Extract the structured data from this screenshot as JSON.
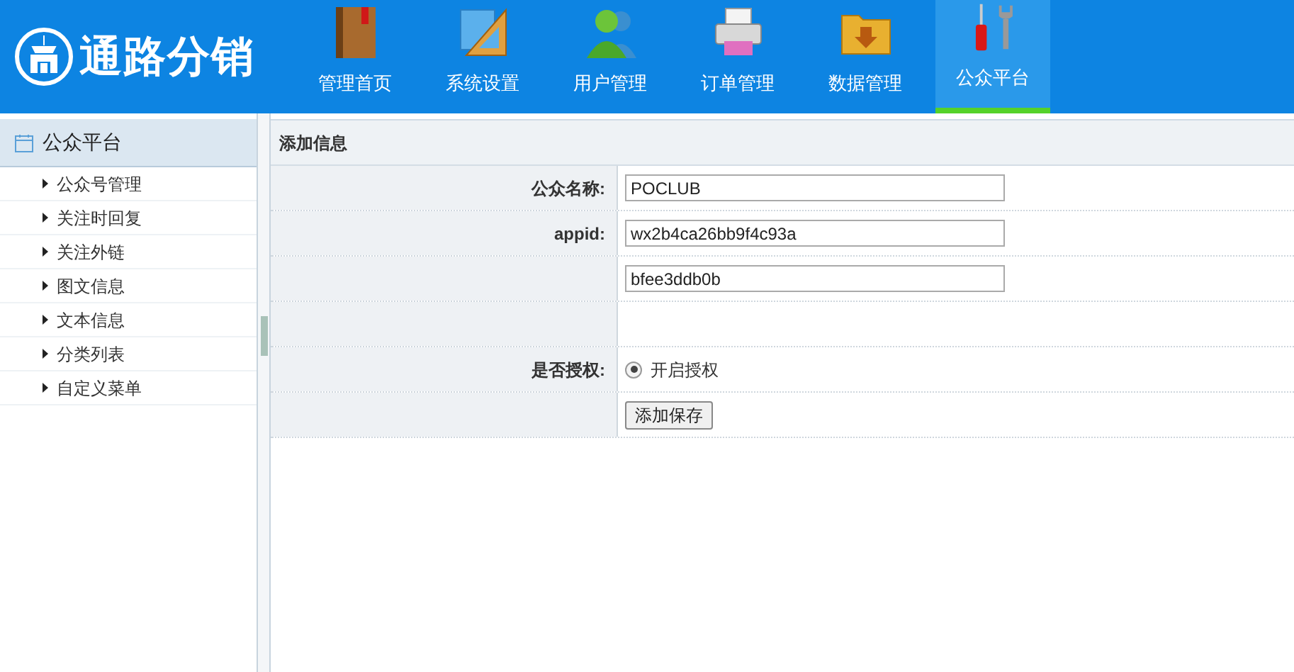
{
  "header": {
    "logo_text": "通路分销",
    "nav": [
      {
        "label": "管理首页",
        "selected": false
      },
      {
        "label": "系统设置",
        "selected": false
      },
      {
        "label": "用户管理",
        "selected": false
      },
      {
        "label": "订单管理",
        "selected": false
      },
      {
        "label": "数据管理",
        "selected": false
      },
      {
        "label": "公众平台",
        "selected": true
      }
    ]
  },
  "sidebar": {
    "title": "公众平台",
    "items": [
      "公众号管理",
      "关注时回复",
      "关注外链",
      "图文信息",
      "文本信息",
      "分类列表",
      "自定义菜单"
    ]
  },
  "form": {
    "title": "添加信息",
    "rows": [
      {
        "kind": "text",
        "label": "公众名称:",
        "value": "POCLUB"
      },
      {
        "kind": "text",
        "label": "appid:",
        "value": "wx2b4ca26bb9f4c93a"
      },
      {
        "kind": "text",
        "value": "bfee3ddb0b"
      },
      {
        "kind": "blank"
      },
      {
        "kind": "radio",
        "label": "是否授权:",
        "option": "开启授权",
        "selected": true
      },
      {
        "kind": "button",
        "button": "添加保存"
      }
    ]
  }
}
